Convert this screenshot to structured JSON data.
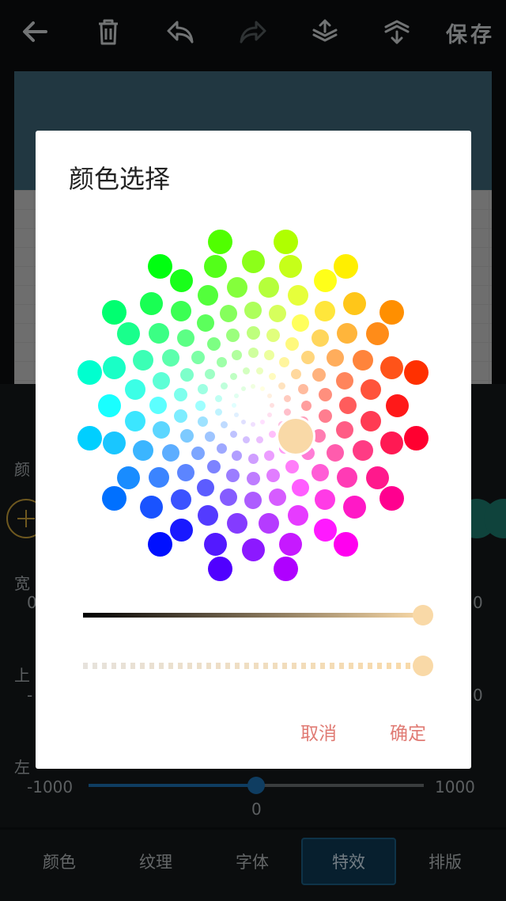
{
  "toolbar": {
    "icons": [
      "back-arrow-icon",
      "trash-icon",
      "undo-icon",
      "redo-icon",
      "layer-up-icon",
      "layer-down-icon"
    ],
    "save_label": "保存"
  },
  "panel": {
    "color_label_partial": "颜",
    "width_label_partial": "宽",
    "width_min_partial": "0",
    "width_max_partial": "0",
    "updown_label_partial": "上",
    "updown_min_partial": "-",
    "updown_max_partial": "0",
    "leftright_label_partial": "左",
    "slider_min": "-1000",
    "slider_max": "1000",
    "slider_value": "0",
    "slider_value_num": 0,
    "slider_range": [
      -1000,
      1000
    ],
    "swatches": [
      "#1c7a6d",
      "#1c7a6d"
    ]
  },
  "nav": {
    "tabs": [
      "颜色",
      "纹理",
      "字体",
      "特效",
      "排版"
    ],
    "active_index": 3
  },
  "dialog": {
    "title": "颜色选择",
    "selected_color": "#f9d9a7",
    "brightness_level": 1.0,
    "alpha_level": 1.0,
    "cancel_label": "取消",
    "confirm_label": "确定"
  },
  "colors": {
    "accent_blue": "#1c6fb1",
    "button_text": "#e07b74",
    "add_button_ring": "#c9a13a"
  }
}
